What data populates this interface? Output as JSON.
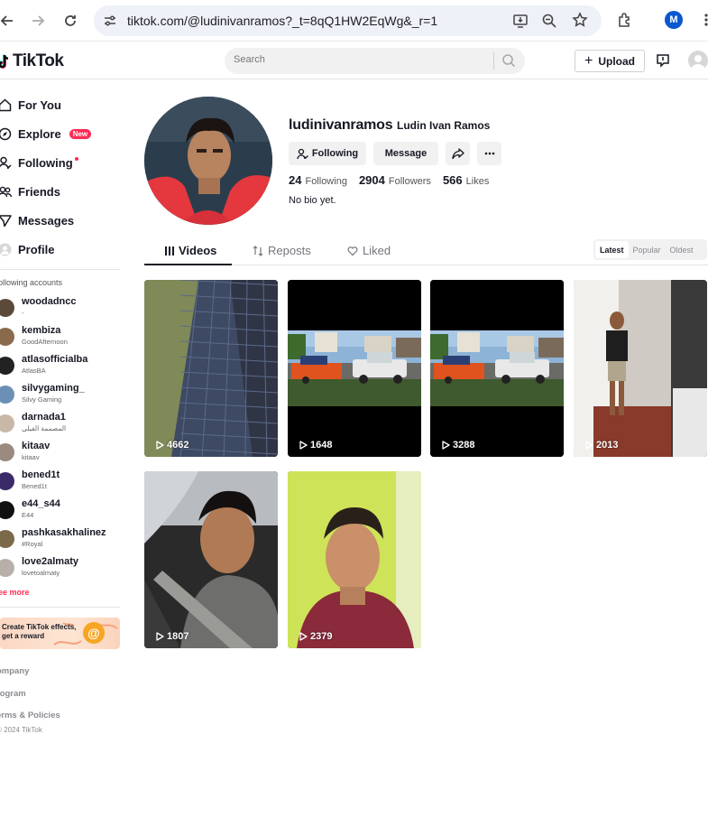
{
  "browser": {
    "url": "tiktok.com/@ludinivanramos?_t=8qQ1HW2EqWg&_r=1",
    "profile_initial": "M"
  },
  "header": {
    "logo": "TikTok",
    "search_placeholder": "Search",
    "upload_label": "Upload"
  },
  "sidebar": {
    "nav": [
      {
        "label": "For You",
        "icon": "home-icon"
      },
      {
        "label": "Explore",
        "icon": "compass-icon",
        "badge": "New"
      },
      {
        "label": "Following",
        "icon": "following-icon"
      },
      {
        "label": "Friends",
        "icon": "friends-icon"
      },
      {
        "label": "Messages",
        "icon": "messages-icon"
      },
      {
        "label": "Profile",
        "icon": "profile-icon"
      }
    ],
    "following_heading": "ollowing accounts",
    "accounts": [
      {
        "name": "woodadncc",
        "sub": "-",
        "color": "#5b4a3a"
      },
      {
        "name": "kembiza",
        "sub": "GoodAfternoon",
        "color": "#8a6a4d"
      },
      {
        "name": "atlasofficialba",
        "sub": "AtlasBA",
        "color": "#222222"
      },
      {
        "name": "silvygaming_",
        "sub": "Silvy Gaming",
        "color": "#6c8fb5"
      },
      {
        "name": "darnada1",
        "sub": "المصممة الفيلي",
        "color": "#c9b7a8"
      },
      {
        "name": "kitaav",
        "sub": "kitaav",
        "color": "#9a8a80"
      },
      {
        "name": "bened1t",
        "sub": "Bened1t",
        "color": "#3b2a6a"
      },
      {
        "name": "e44_s44",
        "sub": "E44",
        "color": "#111111"
      },
      {
        "name": "pashkasakhalinez",
        "sub": "#Royal",
        "color": "#7a6a4a"
      },
      {
        "name": "love2almaty",
        "sub": "lovetoalmaty",
        "color": "#b8b0a8"
      }
    ],
    "see_more": "ee more",
    "effects_banner": "Create TikTok effects, get a reward",
    "footer": [
      "ompany",
      "rogram",
      "erms & Policies"
    ],
    "copyright": "2024 TikTok"
  },
  "profile": {
    "username": "ludinivanramos",
    "display_name": "Ludin Ivan Ramos",
    "following_btn": "Following",
    "message_btn": "Message",
    "stats": {
      "following": "24",
      "following_label": "Following",
      "followers": "2904",
      "followers_label": "Followers",
      "likes": "566",
      "likes_label": "Likes"
    },
    "bio": "No bio yet."
  },
  "tabs": {
    "videos": "Videos",
    "reposts": "Reposts",
    "liked": "Liked"
  },
  "sort": {
    "latest": "Latest",
    "popular": "Popular",
    "oldest": "Oldest"
  },
  "videos": [
    {
      "views": "4662",
      "thumb": "walkway"
    },
    {
      "views": "1648",
      "thumb": "truck-trailer"
    },
    {
      "views": "3288",
      "thumb": "truck-trailer"
    },
    {
      "views": "2013",
      "thumb": "mirror-selfie"
    },
    {
      "views": "1807",
      "thumb": "car-selfie"
    },
    {
      "views": "2379",
      "thumb": "green-wall-selfie"
    }
  ],
  "colors": {
    "accent": "#fe2c55",
    "text": "#161823",
    "muted": "#8a8b91"
  }
}
